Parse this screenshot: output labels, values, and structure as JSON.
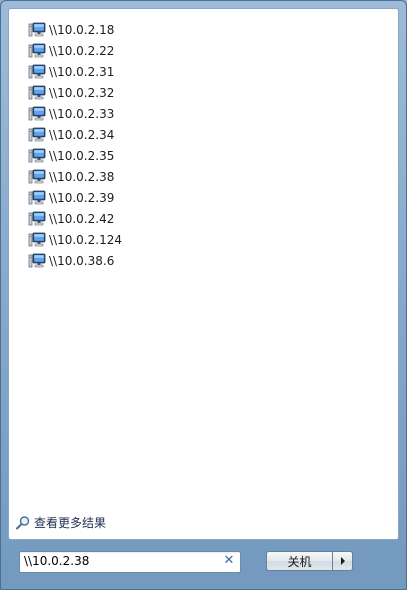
{
  "results": [
    {
      "label": "\\\\10.0.2.18",
      "icon": "network-computer-icon"
    },
    {
      "label": "\\\\10.0.2.22",
      "icon": "network-computer-icon"
    },
    {
      "label": "\\\\10.0.2.31",
      "icon": "network-computer-icon"
    },
    {
      "label": "\\\\10.0.2.32",
      "icon": "network-computer-icon"
    },
    {
      "label": "\\\\10.0.2.33",
      "icon": "network-computer-icon"
    },
    {
      "label": "\\\\10.0.2.34",
      "icon": "network-computer-icon"
    },
    {
      "label": "\\\\10.0.2.35",
      "icon": "network-computer-icon"
    },
    {
      "label": "\\\\10.0.2.38",
      "icon": "network-computer-icon"
    },
    {
      "label": "\\\\10.0.2.39",
      "icon": "network-computer-icon"
    },
    {
      "label": "\\\\10.0.2.42",
      "icon": "network-computer-icon"
    },
    {
      "label": "\\\\10.0.2.124",
      "icon": "network-computer-icon"
    },
    {
      "label": "\\\\10.0.38.6",
      "icon": "network-computer-icon"
    }
  ],
  "more_results": {
    "label": "查看更多结果",
    "icon": "magnifier-icon"
  },
  "search": {
    "value": "\\\\10.0.2.38",
    "clear_icon": "close-icon"
  },
  "shutdown": {
    "label": "关机",
    "arrow_icon": "triangle-right-icon"
  },
  "colors": {
    "frame": "#86a9ca",
    "panel": "#ffffff",
    "link": "#1e2f50",
    "clear_accent": "#3b6aa3"
  }
}
